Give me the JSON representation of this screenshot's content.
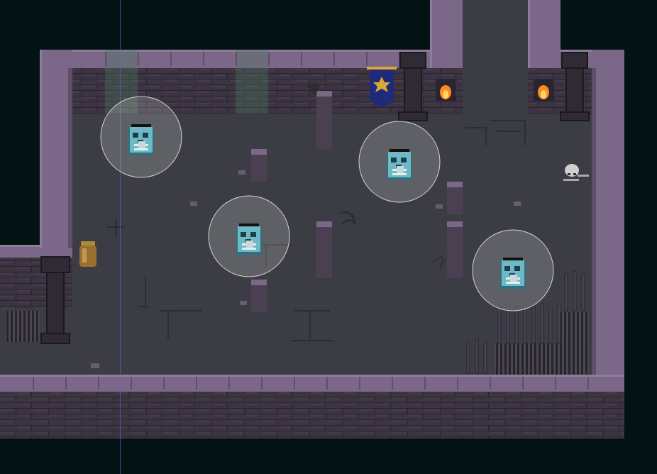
{
  "scene": {
    "type": "top-down pixel-art dungeon room",
    "colors": {
      "void": "#031212",
      "floor": "#3c3d44",
      "floor_crack": "#2c2d33",
      "wall_top": "#7b6889",
      "wall_top_light": "#8f7c9d",
      "wall_face": "#3d3442",
      "brick_line": "#2a2430",
      "pillar": "#2f2a34",
      "banner": "#1f2b78",
      "banner_emblem": "#d9a838",
      "torch_flame": "#ff8a1e",
      "ghost_body": "#6fb9c6",
      "ghost_shadow": "#2f6f80",
      "aggro_circle": "#ffffff"
    },
    "enemies": [
      {
        "name": "ghost-skeleton-1",
        "icon": "ghost-skeleton-icon"
      },
      {
        "name": "ghost-skeleton-2",
        "icon": "ghost-skeleton-icon"
      },
      {
        "name": "ghost-skeleton-3",
        "icon": "ghost-skeleton-icon"
      },
      {
        "name": "ghost-skeleton-4",
        "icon": "ghost-skeleton-icon"
      }
    ],
    "props": [
      {
        "name": "banner",
        "icon": "banner-icon"
      },
      {
        "name": "torch-left",
        "icon": "torch-icon"
      },
      {
        "name": "torch-right",
        "icon": "torch-icon"
      },
      {
        "name": "skull-bones",
        "icon": "skull-icon"
      },
      {
        "name": "clay-pot",
        "icon": "pot-icon"
      },
      {
        "name": "spike-fence",
        "icon": "spikes-icon"
      },
      {
        "name": "floor-grate",
        "icon": "grate-icon"
      }
    ]
  }
}
